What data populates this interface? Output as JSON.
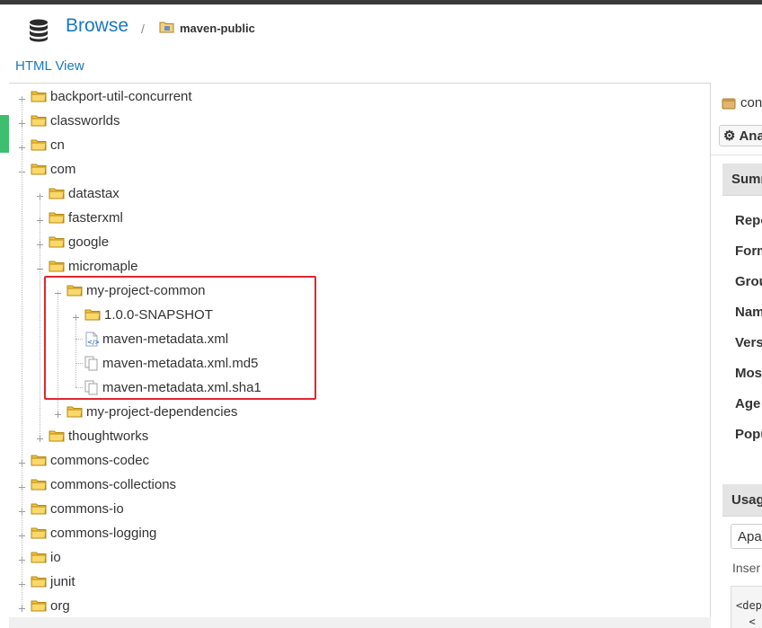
{
  "header": {
    "title": "Browse",
    "separator": "/",
    "repository": "maven-public"
  },
  "html_view_label": "HTML View",
  "tree": [
    {
      "label": "backport-util-concurrent",
      "kind": "folder",
      "level": 0,
      "expanded": false
    },
    {
      "label": "classworlds",
      "kind": "folder",
      "level": 0,
      "expanded": false
    },
    {
      "label": "cn",
      "kind": "folder",
      "level": 0,
      "expanded": false
    },
    {
      "label": "com",
      "kind": "folder",
      "level": 0,
      "expanded": true
    },
    {
      "label": "datastax",
      "kind": "folder",
      "level": 1,
      "expanded": false
    },
    {
      "label": "fasterxml",
      "kind": "folder",
      "level": 1,
      "expanded": false
    },
    {
      "label": "google",
      "kind": "folder",
      "level": 1,
      "expanded": false
    },
    {
      "label": "micromaple",
      "kind": "folder",
      "level": 1,
      "expanded": true
    },
    {
      "label": "my-project-common",
      "kind": "folder",
      "level": 2,
      "expanded": true
    },
    {
      "label": "1.0.0-SNAPSHOT",
      "kind": "folder",
      "level": 3,
      "expanded": false
    },
    {
      "label": "maven-metadata.xml",
      "kind": "xml",
      "level": 3
    },
    {
      "label": "maven-metadata.xml.md5",
      "kind": "file",
      "level": 3
    },
    {
      "label": "maven-metadata.xml.sha1",
      "kind": "file",
      "level": 3
    },
    {
      "label": "my-project-dependencies",
      "kind": "folder",
      "level": 2,
      "expanded": false
    },
    {
      "label": "thoughtworks",
      "kind": "folder",
      "level": 1,
      "expanded": false
    },
    {
      "label": "commons-codec",
      "kind": "folder",
      "level": 0,
      "expanded": false
    },
    {
      "label": "commons-collections",
      "kind": "folder",
      "level": 0,
      "expanded": false
    },
    {
      "label": "commons-io",
      "kind": "folder",
      "level": 0,
      "expanded": false
    },
    {
      "label": "commons-logging",
      "kind": "folder",
      "level": 0,
      "expanded": false
    },
    {
      "label": "io",
      "kind": "folder",
      "level": 0,
      "expanded": false
    },
    {
      "label": "junit",
      "kind": "folder",
      "level": 0,
      "expanded": false
    },
    {
      "label": "org",
      "kind": "folder",
      "level": 0,
      "expanded": false
    }
  ],
  "right_panel": {
    "component_name": "con",
    "analyze_button": "Ana",
    "summary_header": "Summ",
    "summary_fields": [
      "Repo",
      "Form",
      "Grou",
      "Nam",
      "Vers",
      "Mos",
      "Age",
      "Popu"
    ],
    "usage_header": "Usag",
    "usage_select": "Apa",
    "insert_text": "Inser",
    "code_lines": [
      "<dep",
      "  <"
    ]
  },
  "colors": {
    "link_blue": "#1b78c0",
    "highlight_red": "#e0262e",
    "folder_yellow": "#f5c242",
    "accent_green": "#3dbf6f"
  }
}
